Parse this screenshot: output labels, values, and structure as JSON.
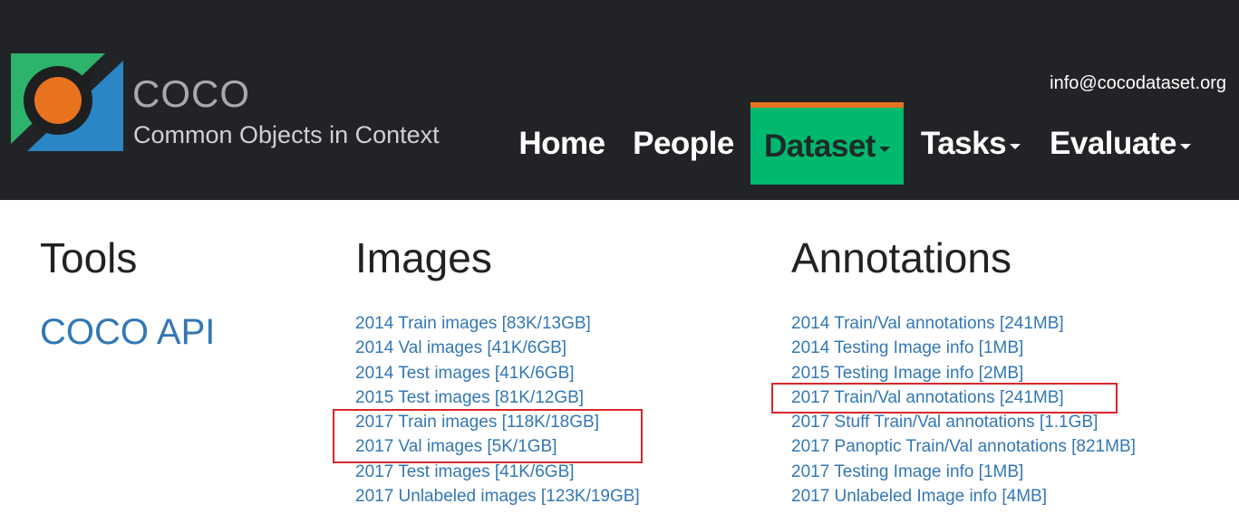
{
  "header": {
    "brand_title": "COCO",
    "brand_subtitle": "Common Objects in Context",
    "email": "info@cocodataset.org",
    "nav": [
      {
        "label": "Home",
        "has_caret": false,
        "active": false
      },
      {
        "label": "People",
        "has_caret": false,
        "active": false
      },
      {
        "label": "Dataset",
        "has_caret": true,
        "active": true
      },
      {
        "label": "Tasks",
        "has_caret": true,
        "active": false
      },
      {
        "label": "Evaluate",
        "has_caret": true,
        "active": false
      }
    ]
  },
  "tools": {
    "title": "Tools",
    "links": [
      "COCO API"
    ]
  },
  "images": {
    "title": "Images",
    "links": [
      "2014 Train images [83K/13GB]",
      "2014 Val images [41K/6GB]",
      "2014 Test images [41K/6GB]",
      "2015 Test images [81K/12GB]",
      "2017 Train images [118K/18GB]",
      "2017 Val images [5K/1GB]",
      "2017 Test images [41K/6GB]",
      "2017 Unlabeled images [123K/19GB]"
    ]
  },
  "annotations": {
    "title": "Annotations",
    "links": [
      "2014 Train/Val annotations [241MB]",
      "2014 Testing Image info [1MB]",
      "2015 Testing Image info [2MB]",
      "2017 Train/Val annotations [241MB]",
      "2017 Stuff Train/Val annotations [1.1GB]",
      "2017 Panoptic Train/Val annotations [821MB]",
      "2017 Testing Image info [1MB]",
      "2017 Unlabeled Image info [4MB]"
    ]
  },
  "colors": {
    "header_bg": "#222326",
    "link": "#3377b5",
    "active_nav_bg": "#00b86e",
    "active_nav_border": "#e8731f",
    "highlight_box": "#d9262b",
    "logo_green": "#2db36b",
    "logo_blue": "#2a86c4",
    "logo_orange": "#e8731f"
  }
}
